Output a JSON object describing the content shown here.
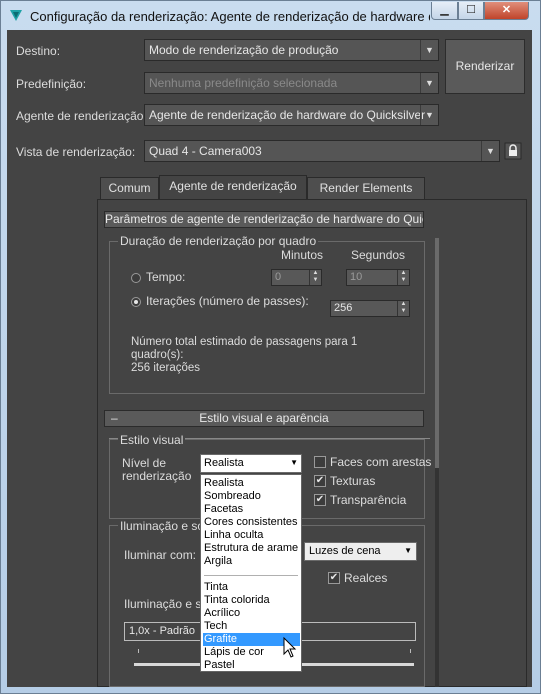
{
  "window": {
    "title": "Configuração da renderização: Agente de renderização de hardware do Qu..."
  },
  "top": {
    "destino_label": "Destino:",
    "destino_value": "Modo de renderização de produção",
    "predef_label": "Predefinição:",
    "predef_value": "Nenhuma predefinição selecionada",
    "agente_label": "Agente de renderização:",
    "agente_value": "Agente de renderização de hardware do Quicksilver",
    "vista_label": "Vista de renderização:",
    "vista_value": "Quad 4 - Camera003",
    "render_button": "Renderizar"
  },
  "tabs": [
    "Comum",
    "Agente de renderização",
    "Render Elements"
  ],
  "params": {
    "header": "Parâmetros de agente de renderização de hardware do Quicksilver",
    "duracao_group": "Duração de renderização por quadro",
    "minutos": "Minutos",
    "segundos": "Segundos",
    "tempo_label": "Tempo:",
    "tempo_min": "0",
    "tempo_sec": "10",
    "iter_label": "Iterações (número de passes):",
    "iter_value": "256",
    "estimate_line1": "Número total estimado de passagens para 1",
    "estimate_line2": "quadro(s):",
    "estimate_line3": "256 iterações"
  },
  "estilo": {
    "header": "Estilo visual e aparência",
    "collapse_glyph": "–",
    "group": "Estilo visual",
    "nivel_label_1": "Nível de",
    "nivel_label_2": "renderização",
    "nivel_value": "Realista",
    "faces_label": "Faces com arestas",
    "texturas_label": "Texturas",
    "transp_label": "Transparência",
    "faces_checked": false,
    "texturas_checked": true,
    "transp_checked": true
  },
  "ilum": {
    "group": "Iluminação e som",
    "iluminar_label": "Iluminar com:",
    "iluminar_value": "Luzes de cena",
    "realces_label": "Realces",
    "realces_checked": true,
    "ilum_sub_label": "Iluminação e so",
    "preset_value": "1,0x - Padrão"
  },
  "dropdown": {
    "items_top": [
      "Realista",
      "Sombreado",
      "Facetas",
      "Cores consistentes",
      "Linha oculta",
      "Estrutura de arame",
      "Argila"
    ],
    "items_bottom": [
      "Tinta",
      "Tinta colorida",
      "Acrílico",
      "Tech",
      "Grafite",
      "Lápis de cor",
      "Pastel"
    ],
    "selected": "Grafite"
  },
  "colors": {
    "accent": "#3399ff",
    "panel": "#444444",
    "frame": "#c9dcef",
    "close": "#c0442a"
  },
  "icons": [
    "app-icon-3dsmax",
    "lock-icon",
    "chevron-down-icon",
    "mouse-cursor-icon"
  ]
}
